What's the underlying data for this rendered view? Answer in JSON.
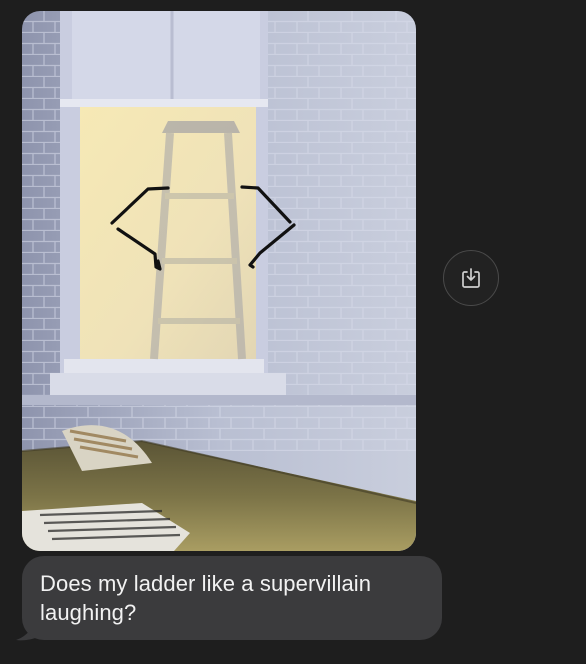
{
  "message": {
    "text": "Does my ladder like a supervillain\nlaughing?"
  },
  "attachment": {
    "kind": "photo",
    "subject": "ladder behind window with drawn face"
  },
  "actions": {
    "save_icon": "save-to-downloads-icon"
  },
  "colors": {
    "background": "#1e1e1e",
    "bubble": "#3b3b3d",
    "text": "#f2f2f2",
    "button_border": "#4a4a4a",
    "icon": "#cfcfcf"
  }
}
